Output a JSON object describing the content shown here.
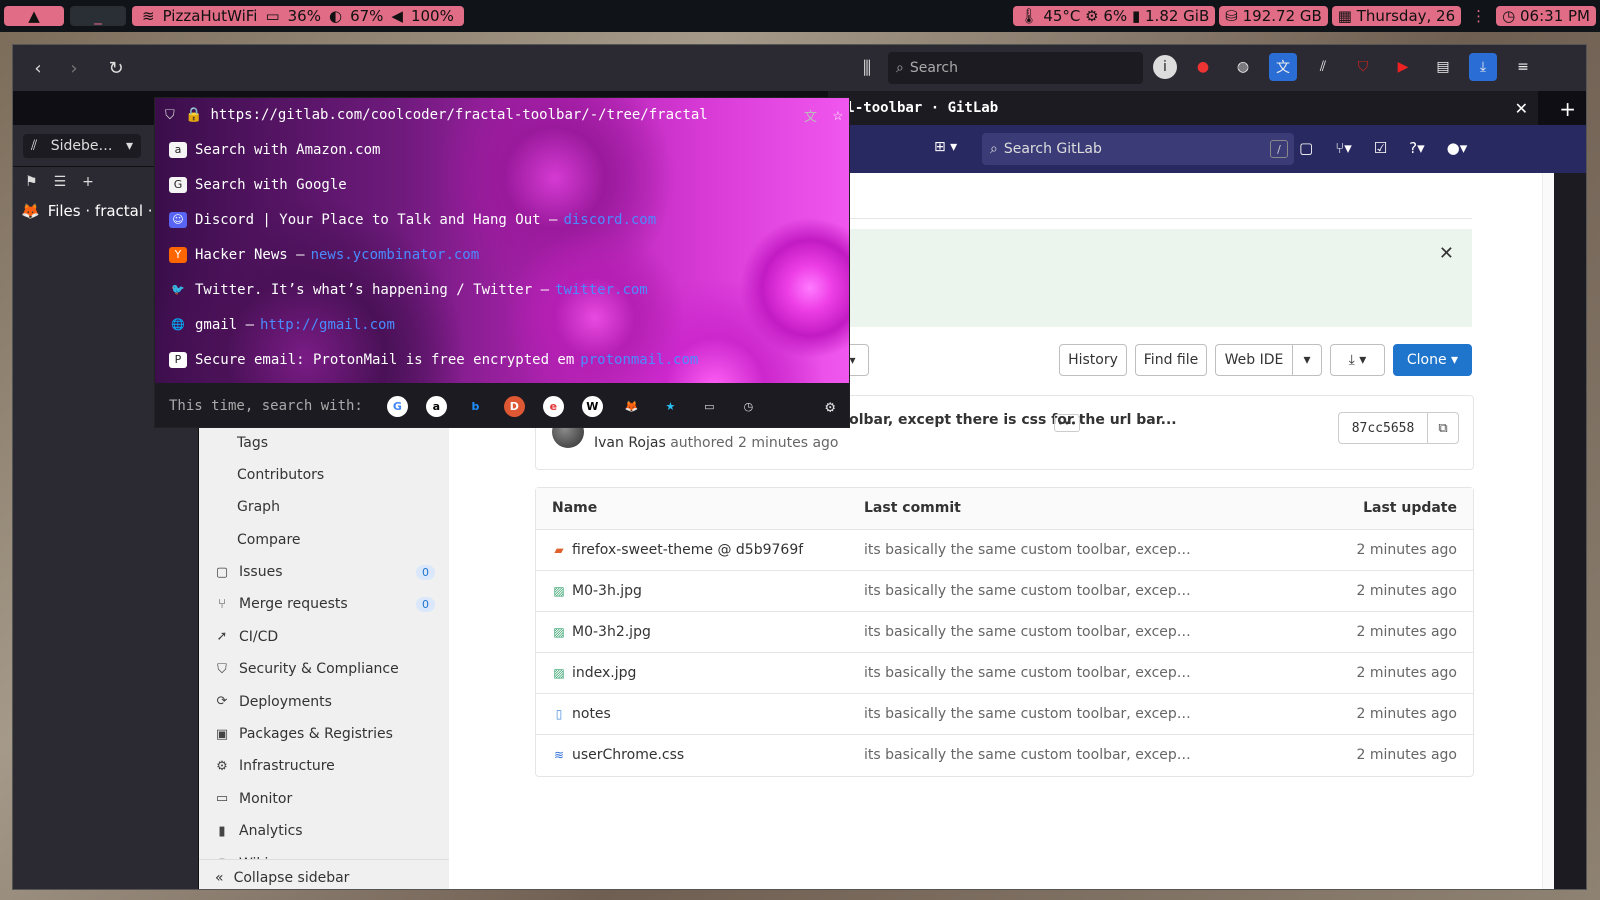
{
  "sysbar": {
    "wifi": "PizzaHutWiFi",
    "battery": "36%",
    "brightness": "67%",
    "volume": "100%",
    "temp": "45°C",
    "cpu": "6%",
    "mem": "1.82 GiB",
    "disk": "192.72 GB",
    "date": "Thursday, 26",
    "time": "06:31 PM"
  },
  "browser": {
    "url": "https://gitlab.com/coolcoder/fractal-toolbar/-/tree/fractal",
    "search_placeholder": "Search",
    "tab_title": "al-toolbar · GitLab",
    "sidebar_select": "Sidebe…",
    "sidebar_item": "Files · fractal ·"
  },
  "dropdown": {
    "suggestions": [
      {
        "text": "Search with Amazon.com",
        "url": "",
        "icon": "amazon-icon",
        "color": "#f5f5f5",
        "glyph": "a"
      },
      {
        "text": "Search with Google",
        "url": "",
        "icon": "google-icon",
        "color": "#f5f5f5",
        "glyph": "G"
      },
      {
        "text": "Discord | Your Place to Talk and Hang Out —",
        "url": "discord.com",
        "icon": "discord-icon",
        "color": "#5865f2",
        "glyph": "☺"
      },
      {
        "text": "Hacker News —",
        "url": "news.ycombinator.com",
        "icon": "ycombinator-icon",
        "color": "#ff6600",
        "glyph": "Y"
      },
      {
        "text": "Twitter. It’s what’s happening / Twitter —",
        "url": "twitter.com",
        "icon": "twitter-icon",
        "color": "transparent",
        "glyph": "🐦"
      },
      {
        "text": "gmail —",
        "url": "http://gmail.com",
        "icon": "globe-icon",
        "color": "transparent",
        "glyph": "🌐"
      },
      {
        "text": "Secure email: ProtonMail is free encrypted em",
        "url": "protonmail.com",
        "icon": "protonmail-icon",
        "color": "#ffffff",
        "glyph": "P"
      }
    ],
    "oneoff_label": "This time, search with:",
    "engines": [
      {
        "name": "google-engine-icon",
        "glyph": "G",
        "bg": "#ffffff",
        "fg": "#4285f4"
      },
      {
        "name": "amazon-engine-icon",
        "glyph": "a",
        "bg": "#ffffff",
        "fg": "#000000"
      },
      {
        "name": "bing-engine-icon",
        "glyph": "b",
        "bg": "transparent",
        "fg": "#1e90ff"
      },
      {
        "name": "duckduckgo-engine-icon",
        "glyph": "D",
        "bg": "#de5833",
        "fg": "#ffffff"
      },
      {
        "name": "ebay-engine-icon",
        "glyph": "e",
        "bg": "#ffffff",
        "fg": "#e53238"
      },
      {
        "name": "wikipedia-engine-icon",
        "glyph": "W",
        "bg": "#ffffff",
        "fg": "#000000"
      },
      {
        "name": "gitlab-engine-icon",
        "glyph": "🦊",
        "bg": "transparent",
        "fg": "#fc6d26"
      },
      {
        "name": "bookmarks-engine-icon",
        "glyph": "★",
        "bg": "transparent",
        "fg": "#2ac3f5"
      },
      {
        "name": "tabs-engine-icon",
        "glyph": "▭",
        "bg": "transparent",
        "fg": "#dddddd"
      },
      {
        "name": "history-engine-icon",
        "glyph": "◷",
        "bg": "transparent",
        "fg": "#dddddd"
      }
    ]
  },
  "gitlab": {
    "search_placeholder": "Search GitLab",
    "search_shortcut": "/",
    "nav": {
      "subitems": [
        "Tags",
        "Contributors",
        "Graph",
        "Compare"
      ],
      "items": [
        {
          "label": "Issues",
          "count": "0",
          "icon": "issues-icon",
          "glyph": "▢"
        },
        {
          "label": "Merge requests",
          "count": "0",
          "icon": "merge-request-icon",
          "glyph": "⑂"
        },
        {
          "label": "CI/CD",
          "count": "",
          "icon": "rocket-icon",
          "glyph": "➚"
        },
        {
          "label": "Security & Compliance",
          "count": "",
          "icon": "shield-icon",
          "glyph": "⛉"
        },
        {
          "label": "Deployments",
          "count": "",
          "icon": "deployments-icon",
          "glyph": "⟳"
        },
        {
          "label": "Packages & Registries",
          "count": "",
          "icon": "package-icon",
          "glyph": "▣"
        },
        {
          "label": "Infrastructure",
          "count": "",
          "icon": "infrastructure-icon",
          "glyph": "⚙"
        },
        {
          "label": "Monitor",
          "count": "",
          "icon": "monitor-icon",
          "glyph": "▭"
        },
        {
          "label": "Analytics",
          "count": "",
          "icon": "analytics-icon",
          "glyph": "▮"
        },
        {
          "label": "Wiki",
          "count": "",
          "icon": "wiki-icon",
          "glyph": "▯"
        }
      ],
      "collapse": "Collapse sidebar"
    },
    "buttons": {
      "history": "History",
      "find_file": "Find file",
      "web_ide": "Web IDE",
      "clone": "Clone"
    },
    "commit": {
      "title": "its basically the same custom toolbar, except there is css for the url bar...",
      "author": "Ivan Rojas",
      "authored": "authored 2 minutes ago",
      "sha": "87cc5658"
    },
    "table": {
      "headers": [
        "Name",
        "Last commit",
        "Last update"
      ],
      "rows": [
        {
          "name": "firefox-sweet-theme @ d5b9769f",
          "commit": "its basically the same custom toolbar, excep…",
          "updated": "2 minutes ago",
          "icon": "submodule-icon",
          "glyph": "▰",
          "color": "#e0602e"
        },
        {
          "name": "M0-3h.jpg",
          "commit": "its basically the same custom toolbar, excep…",
          "updated": "2 minutes ago",
          "icon": "image-file-icon",
          "glyph": "▨",
          "color": "#2d9f68"
        },
        {
          "name": "M0-3h2.jpg",
          "commit": "its basically the same custom toolbar, excep…",
          "updated": "2 minutes ago",
          "icon": "image-file-icon",
          "glyph": "▨",
          "color": "#2d9f68"
        },
        {
          "name": "index.jpg",
          "commit": "its basically the same custom toolbar, excep…",
          "updated": "2 minutes ago",
          "icon": "image-file-icon",
          "glyph": "▨",
          "color": "#2d9f68"
        },
        {
          "name": "notes",
          "commit": "its basically the same custom toolbar, excep…",
          "updated": "2 minutes ago",
          "icon": "text-file-icon",
          "glyph": "▯",
          "color": "#4a90d9"
        },
        {
          "name": "userChrome.css",
          "commit": "its basically the same custom toolbar, excep…",
          "updated": "2 minutes ago",
          "icon": "css-file-icon",
          "glyph": "≋",
          "color": "#2f6fd6"
        }
      ]
    }
  }
}
